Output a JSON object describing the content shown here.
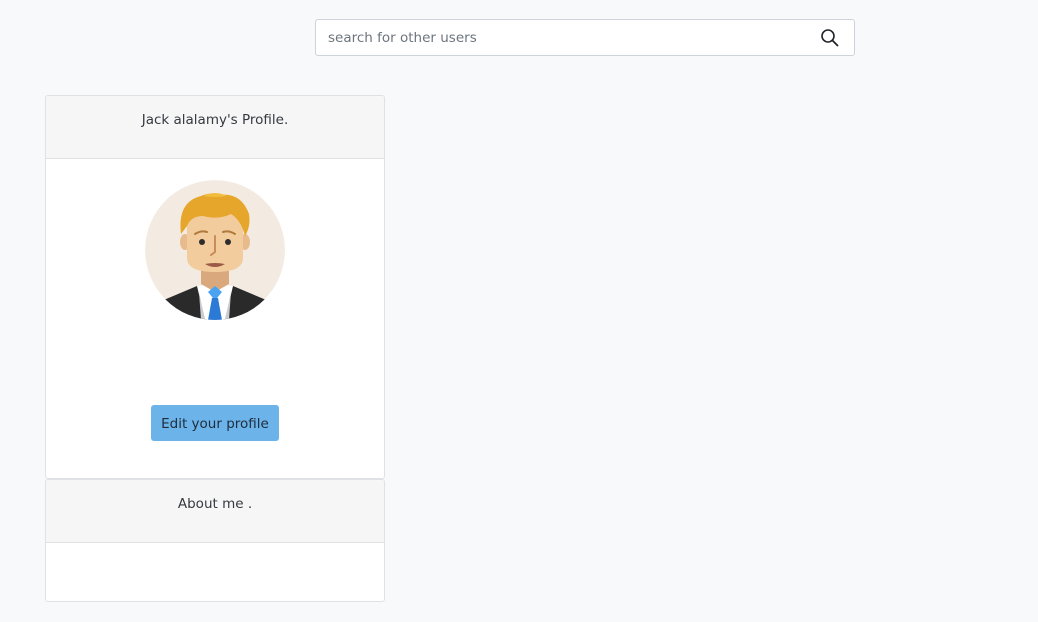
{
  "search": {
    "placeholder": "search for other users",
    "icon": "search-icon"
  },
  "profile": {
    "header": "Jack alalamy's Profile.",
    "avatar_icon": "user-avatar-businessman",
    "edit_label": "Edit your profile"
  },
  "about": {
    "header": "About me .",
    "body": ""
  },
  "colors": {
    "page_background": "#f8f9fb",
    "card_header_background": "#f6f6f6",
    "button_primary": "#6bb3e8",
    "tie_blue": "#2b7bd6"
  }
}
